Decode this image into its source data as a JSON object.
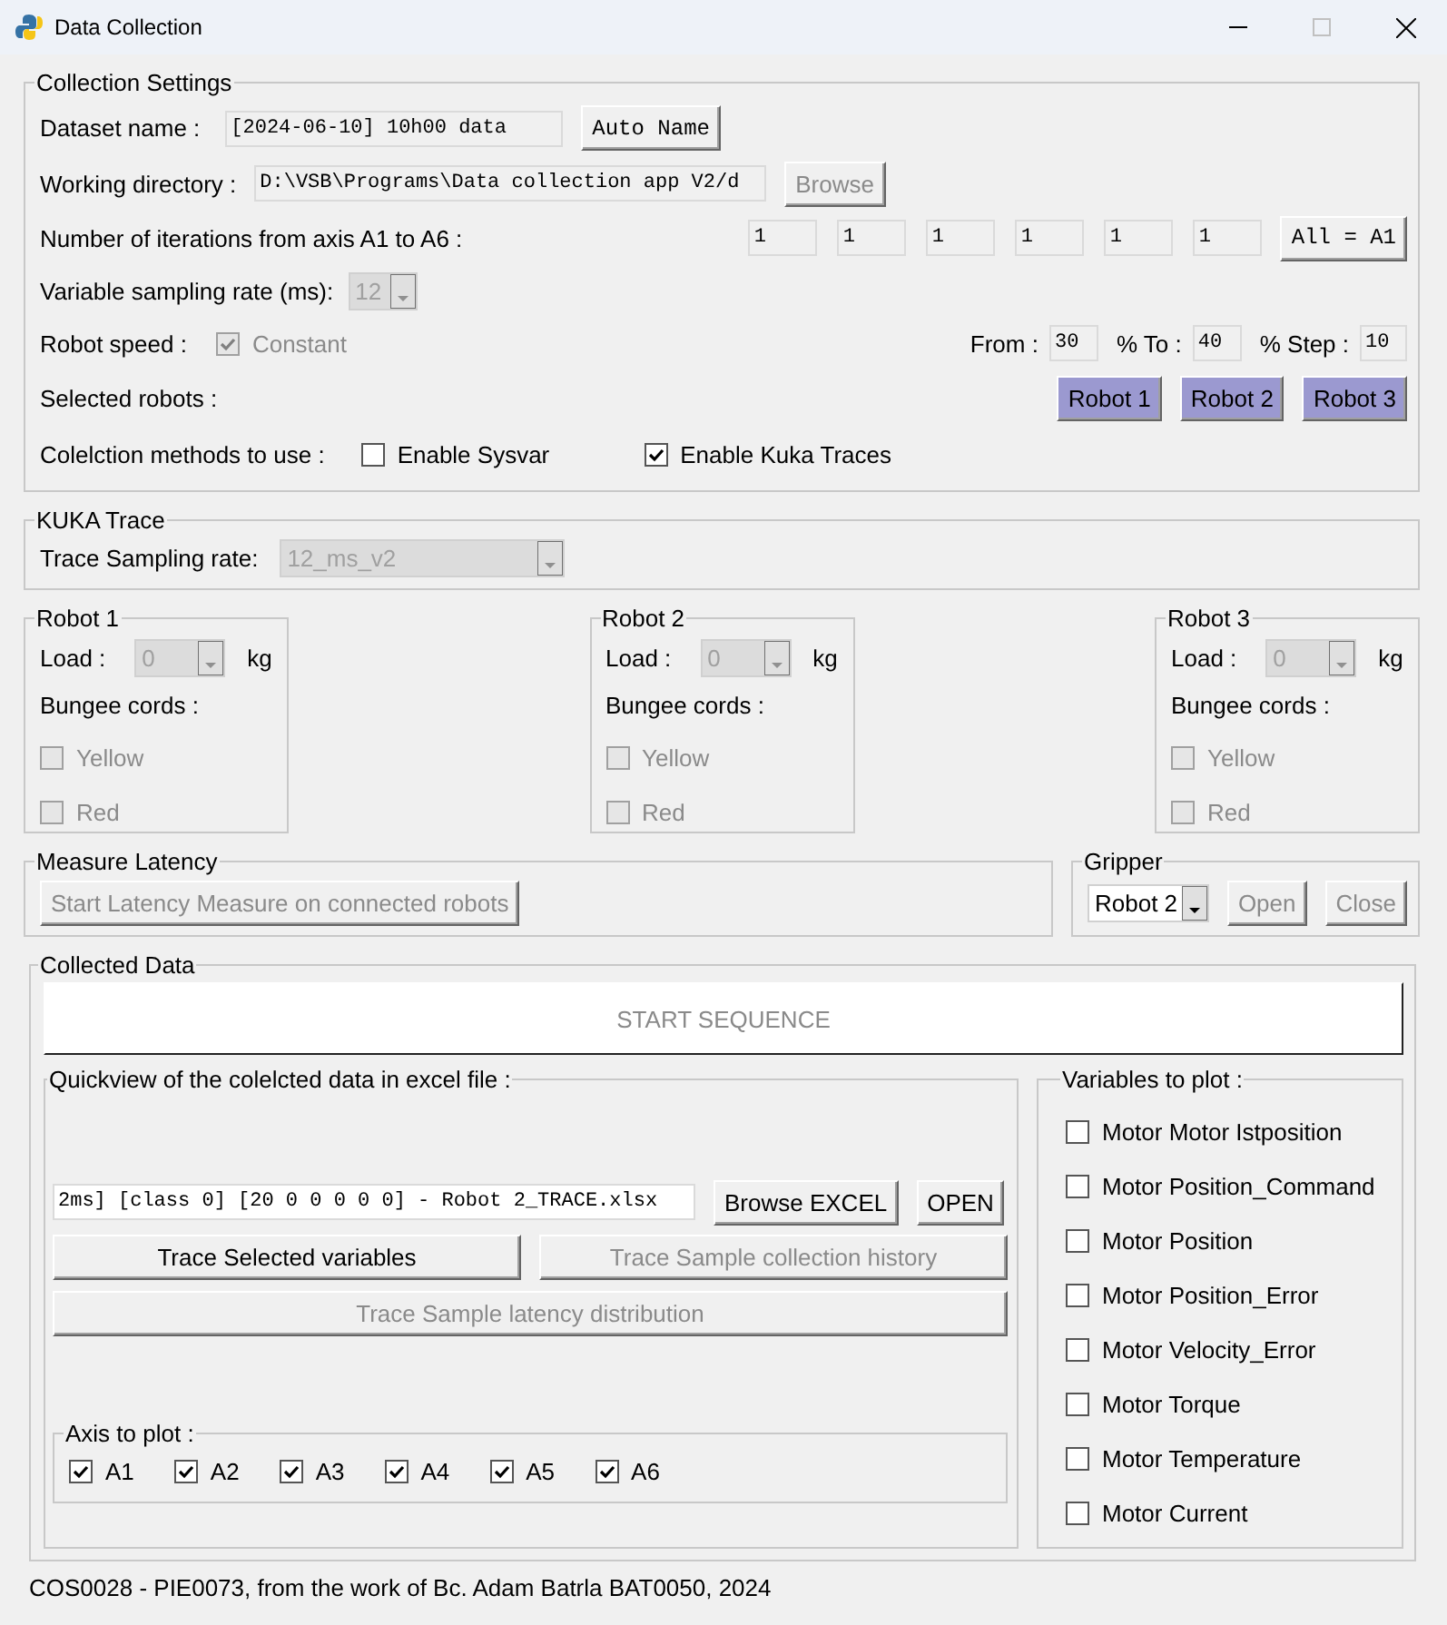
{
  "window": {
    "title": "Data Collection"
  },
  "collection_settings": {
    "title": "Collection Settings",
    "dataset_name": {
      "label": "Dataset name :",
      "value": "[2024-06-10] 10h00 data",
      "button": {
        "label": "Auto Name",
        "disabled": false
      }
    },
    "working_directory": {
      "label": "Working directory :",
      "value": "D:\\VSB\\Programs\\Data collection app V2/d",
      "button": {
        "label": "Browse",
        "disabled": true
      }
    },
    "iterations": {
      "label": "Number of iterations from axis A1 to A6 :",
      "values": [
        "1",
        "1",
        "1",
        "1",
        "1",
        "1"
      ],
      "button": {
        "label": "All = A1",
        "disabled": false
      }
    },
    "sampling_rate": {
      "label": "Variable sampling rate (ms):",
      "value": "12",
      "disabled": true
    },
    "robot_speed": {
      "label": "Robot speed :",
      "constant": {
        "label": "Constant",
        "checked": true,
        "disabled": true
      },
      "from_label": "From :",
      "from": "30",
      "to_label": "% To :",
      "to": "40",
      "step_label": "% Step :",
      "step": "10"
    },
    "selected_robots": {
      "label": "Selected robots :",
      "robots": [
        {
          "label": "Robot 1",
          "selected": true
        },
        {
          "label": "Robot 2",
          "selected": true
        },
        {
          "label": "Robot 3",
          "selected": true
        }
      ]
    },
    "methods": {
      "label": "Colelction methods to use :",
      "options": [
        {
          "label": "Enable Sysvar",
          "checked": false
        },
        {
          "label": "Enable Kuka Traces",
          "checked": true
        }
      ]
    }
  },
  "kuka_trace": {
    "title": "KUKA Trace",
    "label": "Trace Sampling rate:",
    "value": "12_ms_v2",
    "disabled": true
  },
  "robots": [
    {
      "title": "Robot 1",
      "load_label": "Load :",
      "load": "0",
      "load_disabled": true,
      "unit": "kg",
      "bungee_label": "Bungee cords :",
      "cords": [
        {
          "label": "Yellow",
          "checked": false,
          "disabled": true
        },
        {
          "label": "Red",
          "checked": false,
          "disabled": true
        }
      ]
    },
    {
      "title": "Robot 2",
      "load_label": "Load :",
      "load": "0",
      "load_disabled": true,
      "unit": "kg",
      "bungee_label": "Bungee cords :",
      "cords": [
        {
          "label": "Yellow",
          "checked": false,
          "disabled": true
        },
        {
          "label": "Red",
          "checked": false,
          "disabled": true
        }
      ]
    },
    {
      "title": "Robot 3",
      "load_label": "Load :",
      "load": "0",
      "load_disabled": true,
      "unit": "kg",
      "bungee_label": "Bungee cords :",
      "cords": [
        {
          "label": "Yellow",
          "checked": false,
          "disabled": true
        },
        {
          "label": "Red",
          "checked": false,
          "disabled": true
        }
      ]
    }
  ],
  "measure_latency": {
    "title": "Measure Latency",
    "button": {
      "label": "Start Latency Measure on connected robots",
      "disabled": true
    }
  },
  "gripper": {
    "title": "Gripper",
    "value": "Robot 2",
    "disabled": false,
    "buttons": [
      {
        "label": "Open",
        "disabled": true
      },
      {
        "label": "Close",
        "disabled": true
      }
    ]
  },
  "collected_data": {
    "title": "Collected Data",
    "start_button": {
      "label": "START SEQUENCE",
      "disabled": true
    },
    "quickview": {
      "title": "Quickview of the colelcted data in excel file :",
      "file": "2ms] [class 0] [20 0 0 0 0 0] - Robot 2_TRACE.xlsx",
      "buttons": [
        {
          "label": "Browse EXCEL",
          "disabled": false
        },
        {
          "label": "OPEN",
          "disabled": false
        }
      ],
      "trace_buttons": [
        {
          "label": "Trace Selected variables",
          "disabled": false
        },
        {
          "label": "Trace Sample collection history",
          "disabled": true
        },
        {
          "label": "Trace Sample latency distribution",
          "disabled": true
        }
      ],
      "axis": {
        "title": "Axis to plot :",
        "items": [
          {
            "label": "A1",
            "checked": true
          },
          {
            "label": "A2",
            "checked": true
          },
          {
            "label": "A3",
            "checked": true
          },
          {
            "label": "A4",
            "checked": true
          },
          {
            "label": "A5",
            "checked": true
          },
          {
            "label": "A6",
            "checked": true
          }
        ]
      }
    },
    "variables": {
      "title": "Variables to plot :",
      "items": [
        {
          "label": "Motor Motor Istposition",
          "checked": false
        },
        {
          "label": "Motor Position_Command",
          "checked": false
        },
        {
          "label": "Motor Position",
          "checked": false
        },
        {
          "label": "Motor Position_Error",
          "checked": false
        },
        {
          "label": "Motor Velocity_Error",
          "checked": false
        },
        {
          "label": "Motor Torque",
          "checked": false
        },
        {
          "label": "Motor Temperature",
          "checked": false
        },
        {
          "label": "Motor Current",
          "checked": false
        }
      ]
    }
  },
  "status_bar": "COS0028 - PIE0073, from the work of Bc. Adam Batrla BAT0050, 2024"
}
